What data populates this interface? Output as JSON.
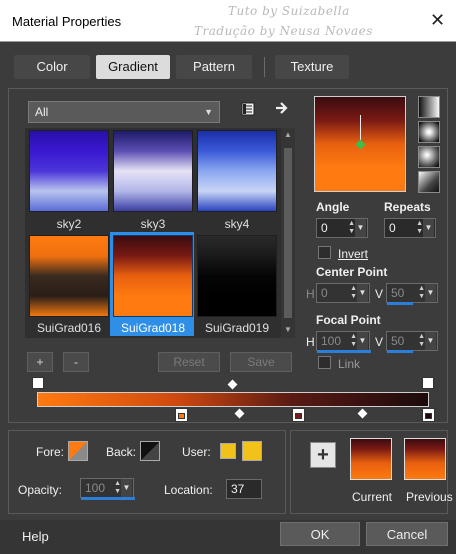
{
  "window": {
    "title": "Material Properties",
    "watermark_line1": "Tuto by  Suizabella",
    "watermark_line2": "Tradução by  Neusa Novaes"
  },
  "tabs": [
    {
      "label": "Color",
      "active": false
    },
    {
      "label": "Gradient",
      "active": true
    },
    {
      "label": "Pattern",
      "active": false
    },
    {
      "label": "Texture",
      "active": false
    }
  ],
  "category_select": {
    "value": "All"
  },
  "gradients": [
    {
      "name": "sky2",
      "colors": [
        "#2a10a8",
        "#3a18d0",
        "#4b35d8",
        "#b8c4ef",
        "#5a6cd8"
      ]
    },
    {
      "name": "sky3",
      "colors": [
        "#1d1b6a",
        "#5b4fb2",
        "#e5e2f6",
        "#b3b7e8",
        "#3b3ea3"
      ]
    },
    {
      "name": "sky4",
      "colors": [
        "#1b2fa8",
        "#3a5ad8",
        "#8aa7f0",
        "#c9d5f6",
        "#2943bf"
      ]
    },
    {
      "name": "SuiGrad016",
      "colors": [
        "#ff7a10",
        "#f07010",
        "#3a2a20",
        "#2a1e18",
        "#f07810"
      ]
    },
    {
      "name": "SuiGrad018",
      "colors": [
        "#3a0c10",
        "#7a1a14",
        "#e86010",
        "#ff7a10",
        "#ff7a10"
      ],
      "selected": true
    },
    {
      "name": "SuiGrad019",
      "colors": [
        "#2a2a2a",
        "#1a1a1a",
        "#050505",
        "#000000",
        "#000000"
      ]
    }
  ],
  "list_buttons": {
    "add": "+",
    "remove": "-",
    "reset": "Reset",
    "save": "Save"
  },
  "angle": {
    "label": "Angle",
    "value": "0"
  },
  "repeats": {
    "label": "Repeats",
    "value": "0"
  },
  "invert": {
    "label": "Invert",
    "checked": false
  },
  "center_point": {
    "label": "Center Point",
    "h_label": "H",
    "h_value": "0",
    "v_label": "V",
    "v_value": "50"
  },
  "focal_point": {
    "label": "Focal Point",
    "h_label": "H",
    "h_value": "100",
    "v_label": "V",
    "v_value": "50"
  },
  "link": {
    "label": "Link",
    "checked": false
  },
  "colors_row": {
    "fore_label": "Fore:",
    "back_label": "Back:",
    "user_label": "User:",
    "user_colors": [
      "#f2c21a",
      "#f2c21a"
    ],
    "opacity_label": "Opacity:",
    "opacity_value": "100",
    "location_label": "Location:",
    "location_value": "37"
  },
  "preview": {
    "current_label": "Current",
    "previous_label": "Previous",
    "add_symbol": "+"
  },
  "footer": {
    "help": "Help",
    "ok": "OK",
    "cancel": "Cancel"
  },
  "icons": {
    "close": "close-icon",
    "library": "library-icon",
    "arrow": "arrow-right-icon",
    "linear": "linear-gradient-icon",
    "rectangular": "rectangular-gradient-icon",
    "sunburst": "sunburst-gradient-icon",
    "radial": "radial-gradient-icon"
  },
  "accent_color": "#2f8fe6"
}
